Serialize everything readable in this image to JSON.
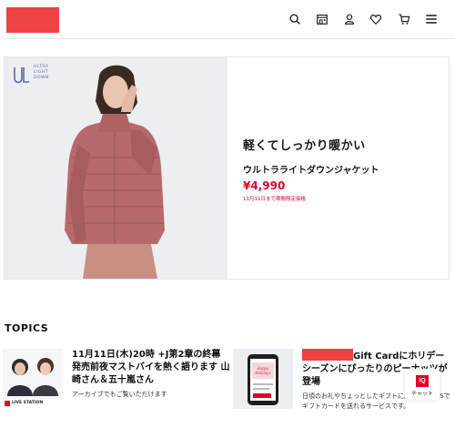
{
  "header": {
    "logo_color": "#ef4242",
    "icons": [
      "search-icon",
      "store-icon",
      "account-icon",
      "wishlist-icon",
      "cart-icon",
      "menu-icon"
    ]
  },
  "hero": {
    "brand_logo_lines": [
      "ULTRA",
      "LIGHT",
      "DOWN"
    ],
    "headline": "軽くてしっかり暖かい",
    "product_name": "ウルトラライトダウンジャケット",
    "price": "¥4,990",
    "note": "11月11日まで期間限定価格"
  },
  "topics": {
    "section_title": "TOPICS",
    "items": [
      {
        "title": "11月11日(木)20時 +J第2章の終幕 発売前夜マストバイを熱く語ります 山崎さん＆五十嵐さん",
        "description": "アーカイブでもご覧いただけます",
        "thumb_caption": "LIVE STATION"
      },
      {
        "title": "Gift Cardにホリデーシーズンにぴったりのピーナッツが登場",
        "description": "日頃のお礼やちょっとしたギフトに。LINEやSNSでギフトカードを送れるサービスです。",
        "thumb_caption": "Happy Holidays"
      }
    ]
  },
  "chat": {
    "badge": "IQ",
    "label": "チャット"
  },
  "colors": {
    "accent_red": "#e00024",
    "redaction": "#ef4242"
  }
}
